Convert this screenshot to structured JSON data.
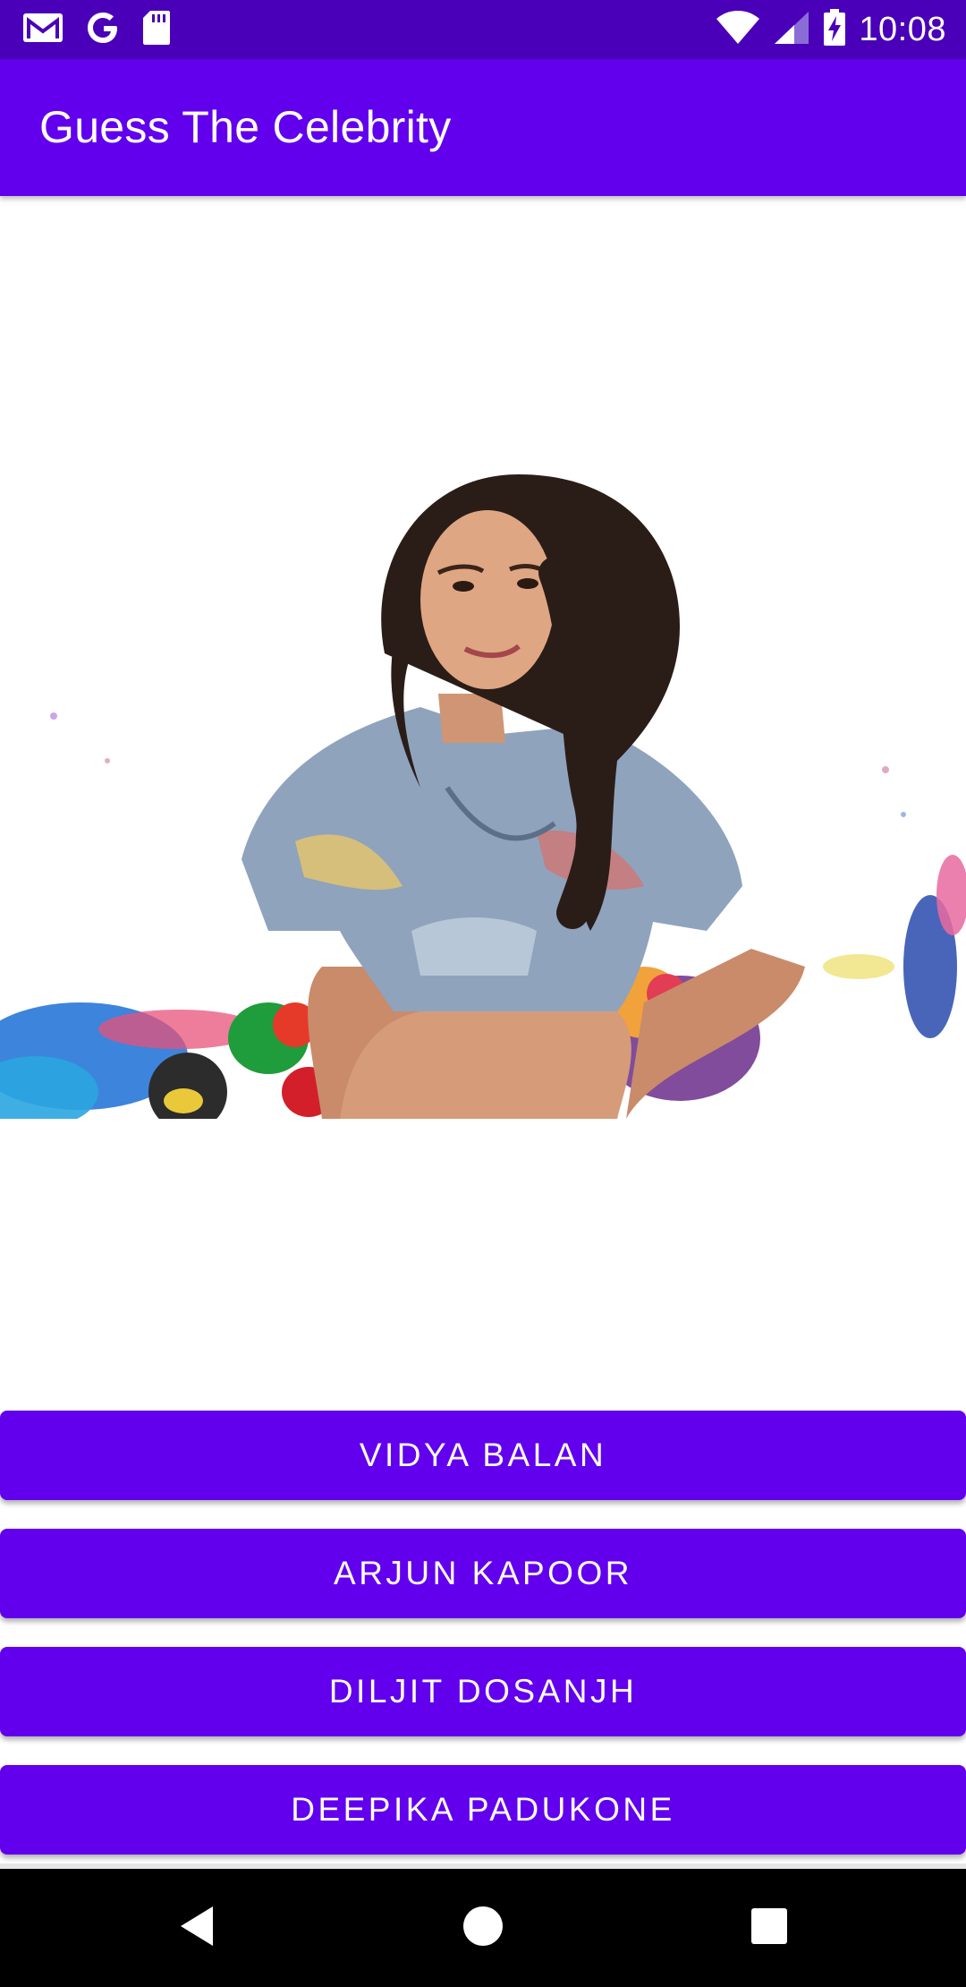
{
  "status_bar": {
    "time": "10:08",
    "left_icons": [
      "gmail-icon",
      "google-icon",
      "sd-card-icon"
    ],
    "right_icons": [
      "wifi-icon",
      "signal-icon",
      "battery-charging-icon"
    ]
  },
  "app_bar": {
    "title": "Guess The Celebrity"
  },
  "main": {
    "image": "celebrity-photo",
    "answers": [
      {
        "label": "VIDYA BALAN"
      },
      {
        "label": "ARJUN KAPOOR"
      },
      {
        "label": "DILJIT DOSANJH"
      },
      {
        "label": "DEEPIKA PADUKONE"
      }
    ]
  },
  "nav_bar": {
    "buttons": [
      "back-icon",
      "home-icon",
      "recents-icon"
    ]
  },
  "colors": {
    "status_bar": "#4a00b8",
    "primary": "#6200ee",
    "button_text": "#ffffff",
    "background": "#ffffff",
    "nav_bar": "#000000"
  }
}
